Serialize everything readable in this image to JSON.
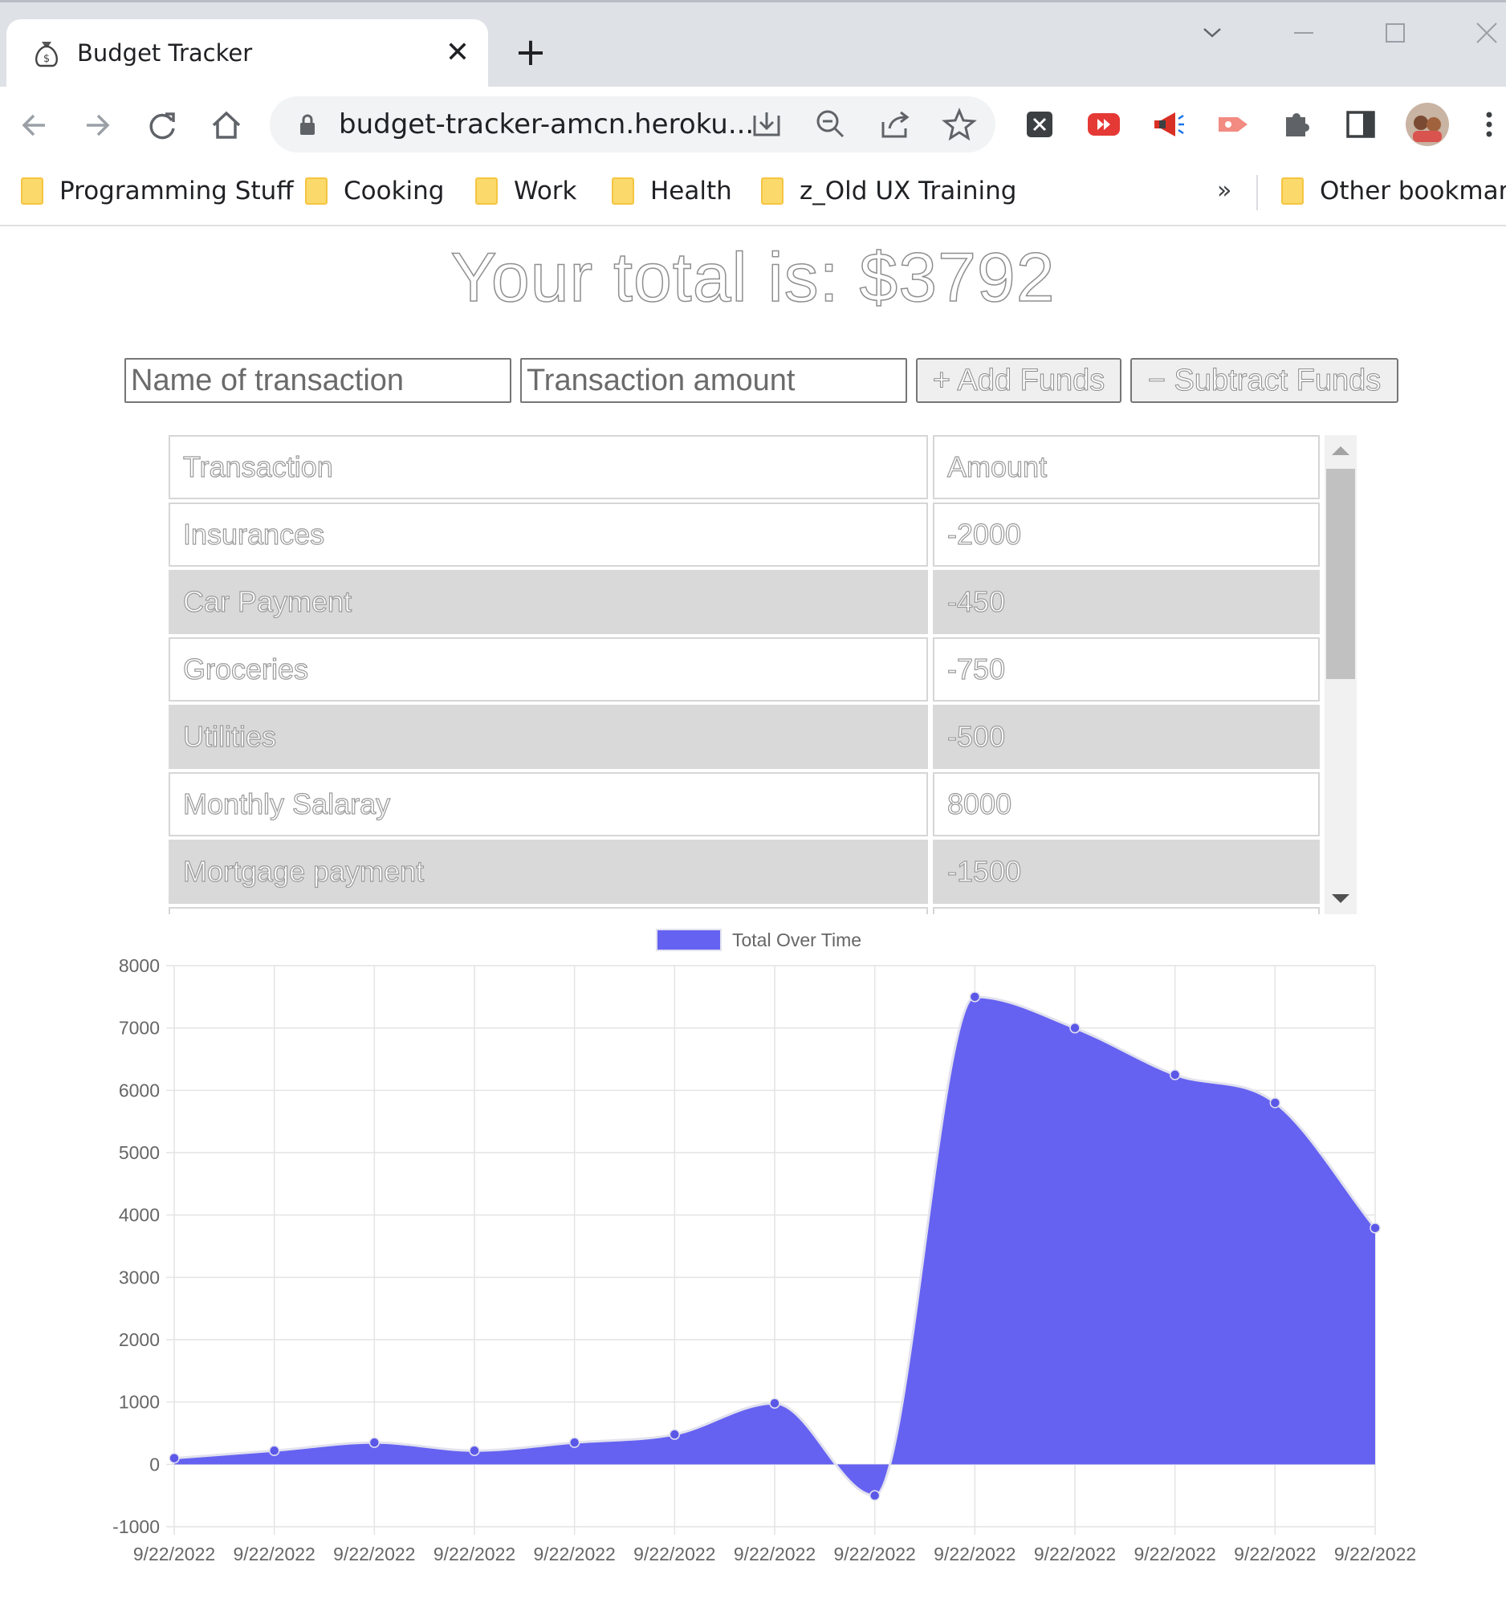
{
  "browser": {
    "tab_title": "Budget Tracker",
    "tab_close": "✕",
    "new_tab": "+",
    "url": "budget-tracker-amcn.heroku...",
    "bookmarks": [
      {
        "label": "Programming Stuff"
      },
      {
        "label": "Cooking"
      },
      {
        "label": "Work"
      },
      {
        "label": "Health"
      },
      {
        "label": "z_Old UX Training"
      }
    ],
    "more_bookmarks": "»",
    "other_bookmarks": "Other bookmarks"
  },
  "page": {
    "total_label": "Your total is: $3792",
    "name_placeholder": "Name of transaction",
    "amount_placeholder": "Transaction amount",
    "add_funds": "Add Funds",
    "subtract_funds": "Subtract Funds",
    "add_symbol": "+",
    "subtract_symbol": "−"
  },
  "table": {
    "headers": [
      "Transaction",
      "Amount"
    ],
    "rows": [
      {
        "name": "Insurances",
        "amount": "-2000"
      },
      {
        "name": "Car Payment",
        "amount": "-450"
      },
      {
        "name": "Groceries",
        "amount": "-750"
      },
      {
        "name": "Utilities",
        "amount": "-500"
      },
      {
        "name": "Monthly Salaray",
        "amount": "8000"
      },
      {
        "name": "Mortgage payment",
        "amount": "-1500"
      }
    ]
  },
  "chart_data": {
    "type": "area",
    "title": "",
    "legend": "Total Over Time",
    "legend_position": "top-center",
    "grid": true,
    "x": [
      "9/22/2022",
      "9/22/2022",
      "9/22/2022",
      "9/22/2022",
      "9/22/2022",
      "9/22/2022",
      "9/22/2022",
      "9/22/2022",
      "9/22/2022",
      "9/22/2022",
      "9/22/2022",
      "9/22/2022",
      "9/22/2022"
    ],
    "series": [
      {
        "name": "Total Over Time",
        "values": [
          100,
          220,
          350,
          220,
          350,
          480,
          980,
          -500,
          7500,
          7000,
          6250,
          5800,
          3792
        ]
      }
    ],
    "ylim": [
      -1000,
      8000
    ],
    "yticks": [
      -1000,
      0,
      1000,
      2000,
      3000,
      4000,
      5000,
      6000,
      7000,
      8000
    ],
    "colors": {
      "fill": "#6562f2",
      "line": "#e2e2ee",
      "point": "#5b58e8",
      "grid": "#e4e4e4"
    }
  }
}
